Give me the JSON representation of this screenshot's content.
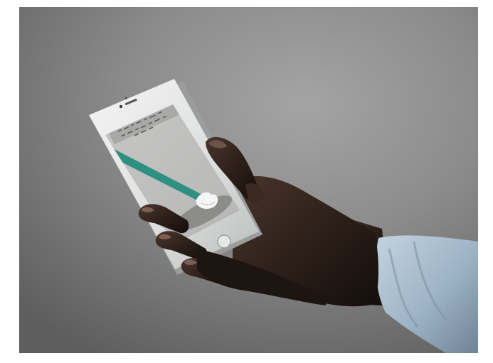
{
  "scene": {
    "subject": "hand-holding-smartphone",
    "background_color": "#8f8f8f",
    "phone_body_color": "#eceeed",
    "screen_color": "#bdbdbc",
    "accent_color": "#2f8f80",
    "sleeve_color": "#a9c0d3",
    "skin_color": "#2a1e18"
  },
  "screen": {
    "caption_visible": true,
    "caption_legible": false
  }
}
